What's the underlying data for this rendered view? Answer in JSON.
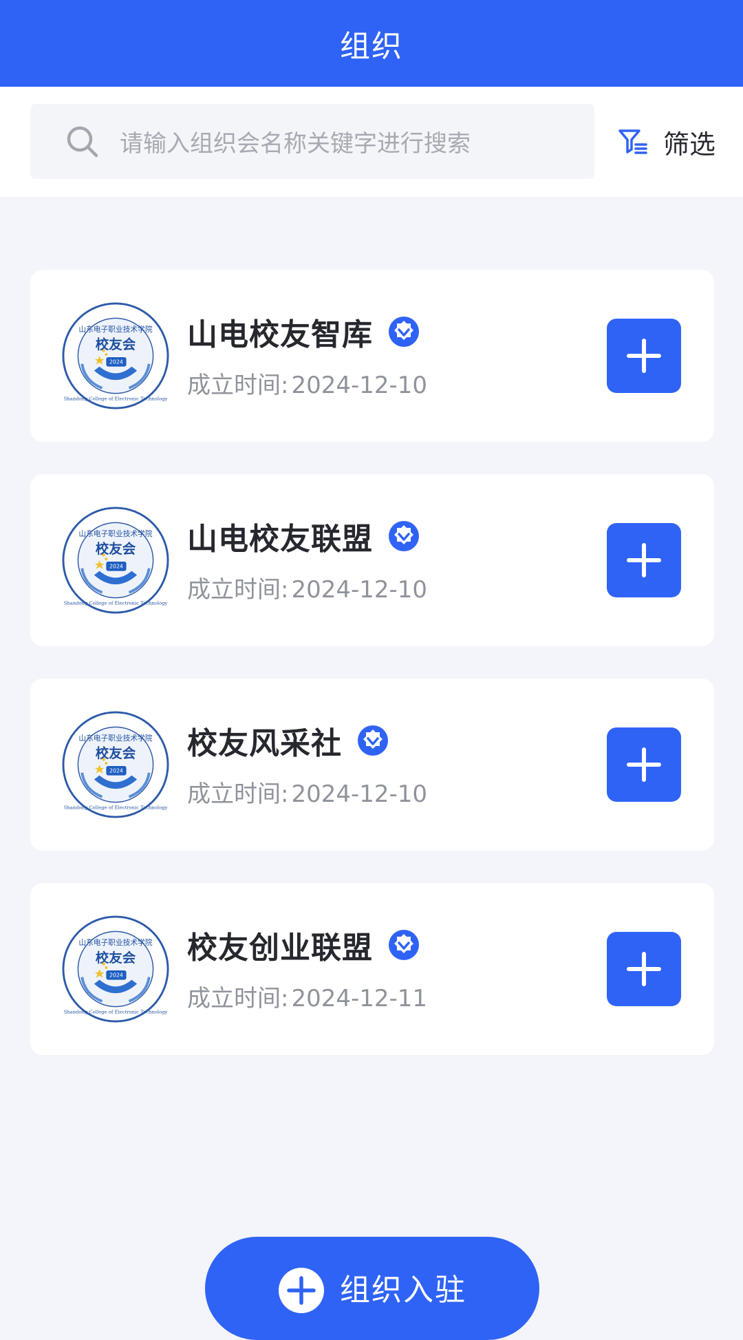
{
  "header": {
    "title": "组织"
  },
  "search": {
    "placeholder": "请输入组织会名称关键字进行搜索",
    "filter_label": "筛选"
  },
  "colors": {
    "primary": "#2f63f6",
    "background": "#f3f5fa",
    "card": "#ffffff",
    "title_text": "#26282e",
    "secondary_text": "#8f939b"
  },
  "logo": {
    "top_text": "山东电子职业技术学院",
    "center_text": "校友会",
    "year": "2024",
    "bottom_text": "Shandong College of Electronic Technology"
  },
  "organizations": [
    {
      "name": "山电校友智库",
      "date_label": "成立时间:",
      "date": "2024-12-10",
      "verified_icon": "verified-badge-icon",
      "add_icon": "plus-icon"
    },
    {
      "name": "山电校友联盟",
      "date_label": "成立时间:",
      "date": "2024-12-10",
      "verified_icon": "verified-badge-icon",
      "add_icon": "plus-icon"
    },
    {
      "name": "校友风采社",
      "date_label": "成立时间:",
      "date": "2024-12-10",
      "verified_icon": "verified-badge-icon",
      "add_icon": "plus-icon"
    },
    {
      "name": "校友创业联盟",
      "date_label": "成立时间:",
      "date": "2024-12-11",
      "verified_icon": "verified-badge-icon",
      "add_icon": "plus-icon"
    }
  ],
  "footer": {
    "join_label": "组织入驻"
  }
}
